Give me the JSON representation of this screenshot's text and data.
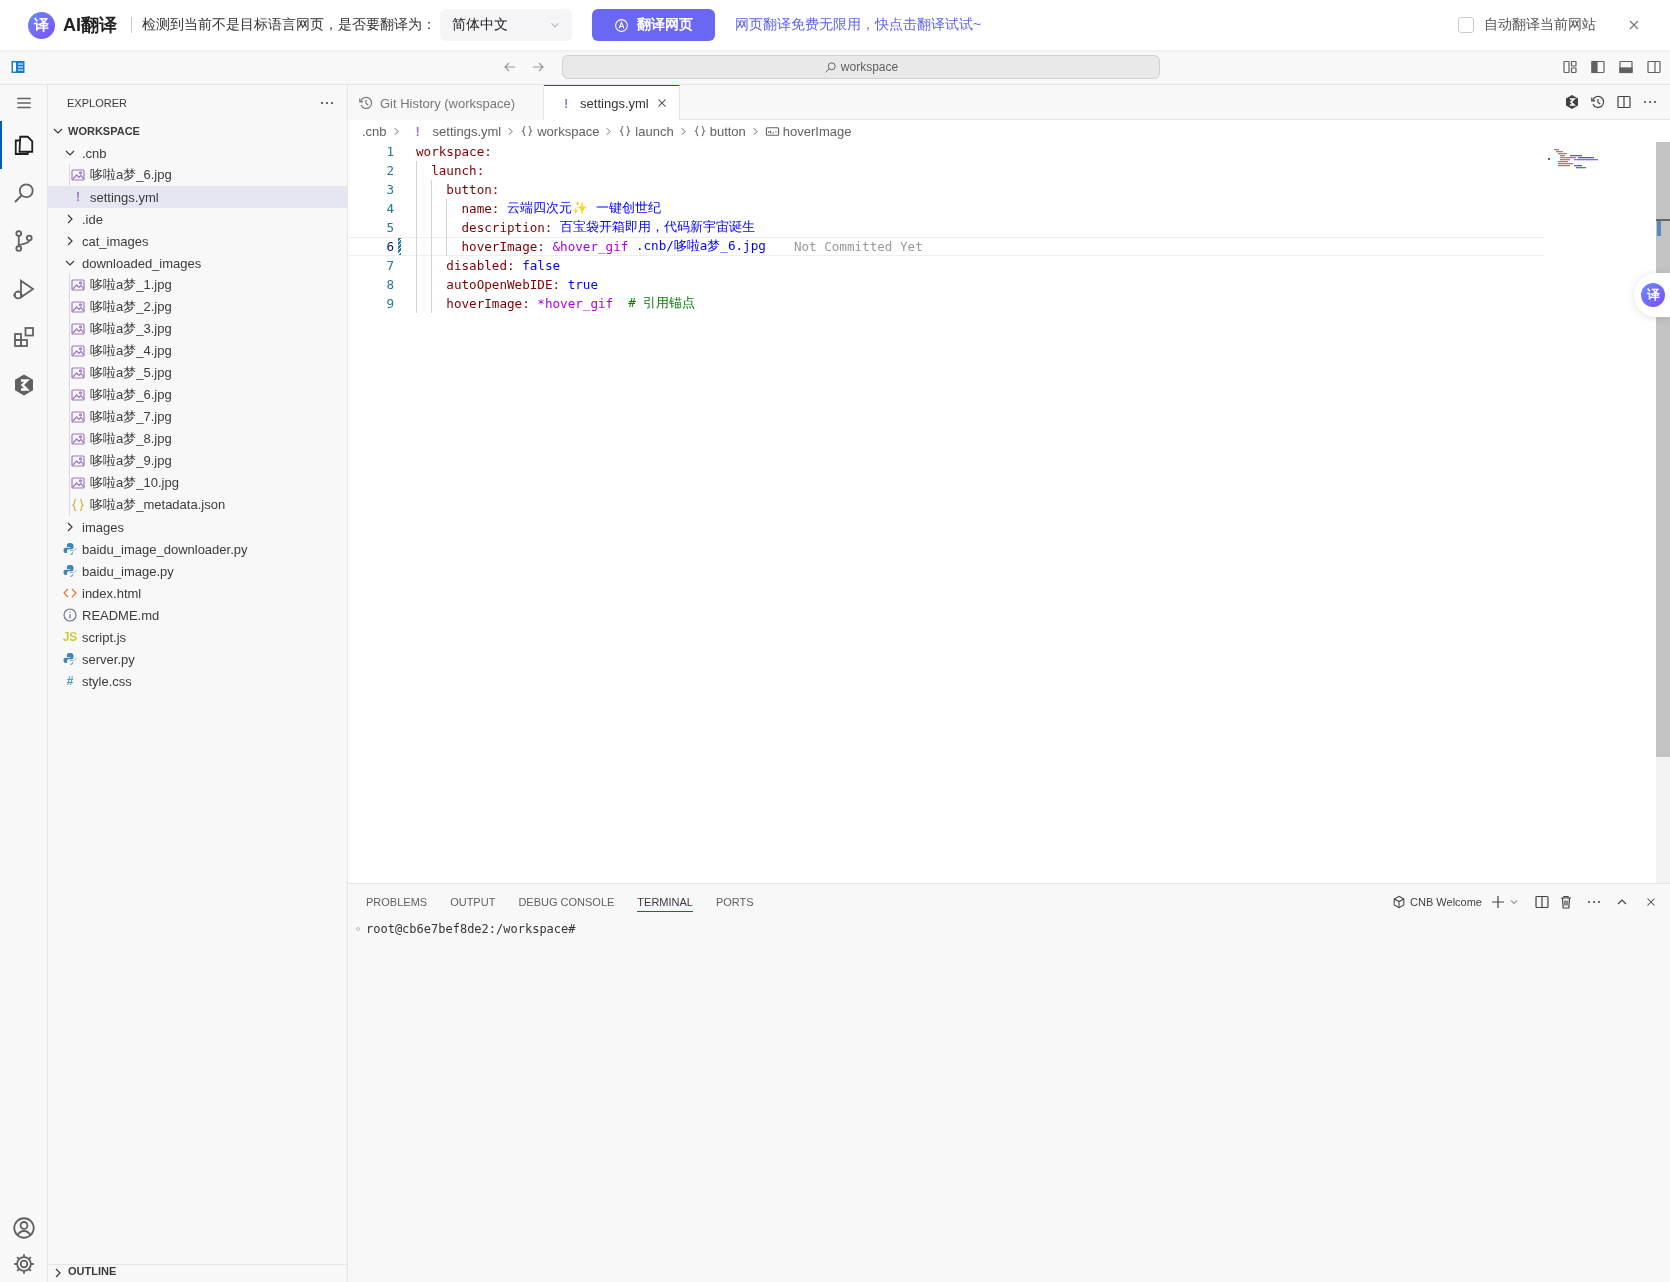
{
  "translate_bar": {
    "logo_icon_text": "译",
    "brand": "AI翻译",
    "prompt": "检测到当前不是目标语言网页，是否要翻译为：",
    "language_select": {
      "value": "简体中文"
    },
    "translate_button": "翻译网页",
    "promo_link": "网页翻译免费无限用，快点击翻译试试~",
    "auto_translate": {
      "label": "自动翻译当前网站",
      "checked": false
    }
  },
  "title_bar": {
    "command_center": "workspace"
  },
  "activity_bar": {
    "items": [
      {
        "kind": "explorer",
        "selected": true
      },
      {
        "kind": "search",
        "selected": false
      },
      {
        "kind": "source-control",
        "selected": false
      },
      {
        "kind": "run-debug",
        "selected": false
      },
      {
        "kind": "extensions",
        "selected": false
      },
      {
        "kind": "cnb",
        "selected": false
      }
    ],
    "bottom_items": [
      {
        "kind": "account"
      },
      {
        "kind": "settings"
      }
    ]
  },
  "explorer": {
    "title": "EXPLORER",
    "section": {
      "title": "WORKSPACE",
      "expanded": true
    },
    "tree": [
      {
        "label": ".cnb",
        "kind": "folder",
        "expanded": true,
        "selected": false,
        "children": [
          {
            "label": "哆啦a梦_6.jpg",
            "kind": "image",
            "selected": false
          },
          {
            "label": "settings.yml",
            "kind": "yaml",
            "icon_text": "!",
            "selected": true
          }
        ]
      },
      {
        "label": ".ide",
        "kind": "folder",
        "expanded": false,
        "selected": false
      },
      {
        "label": "cat_images",
        "kind": "folder",
        "expanded": false,
        "selected": false
      },
      {
        "label": "downloaded_images",
        "kind": "folder",
        "expanded": true,
        "selected": false,
        "children": [
          {
            "label": "哆啦a梦_1.jpg",
            "kind": "image",
            "selected": false
          },
          {
            "label": "哆啦a梦_2.jpg",
            "kind": "image",
            "selected": false
          },
          {
            "label": "哆啦a梦_3.jpg",
            "kind": "image",
            "selected": false
          },
          {
            "label": "哆啦a梦_4.jpg",
            "kind": "image",
            "selected": false
          },
          {
            "label": "哆啦a梦_5.jpg",
            "kind": "image",
            "selected": false
          },
          {
            "label": "哆啦a梦_6.jpg",
            "kind": "image",
            "selected": false
          },
          {
            "label": "哆啦a梦_7.jpg",
            "kind": "image",
            "selected": false
          },
          {
            "label": "哆啦a梦_8.jpg",
            "kind": "image",
            "selected": false
          },
          {
            "label": "哆啦a梦_9.jpg",
            "kind": "image",
            "selected": false
          },
          {
            "label": "哆啦a梦_10.jpg",
            "kind": "image",
            "selected": false
          },
          {
            "label": "哆啦a梦_metadata.json",
            "kind": "json",
            "selected": false
          }
        ]
      },
      {
        "label": "images",
        "kind": "folder",
        "expanded": false,
        "selected": false
      },
      {
        "label": "baidu_image_downloader.py",
        "kind": "python",
        "selected": false
      },
      {
        "label": "baidu_image.py",
        "kind": "python",
        "selected": false
      },
      {
        "label": "index.html",
        "kind": "html",
        "selected": false
      },
      {
        "label": "README.md",
        "kind": "info",
        "selected": false
      },
      {
        "label": "script.js",
        "kind": "js",
        "icon_text": "JS",
        "selected": false
      },
      {
        "label": "server.py",
        "kind": "python",
        "selected": false
      },
      {
        "label": "style.css",
        "kind": "css",
        "icon_text": "#",
        "selected": false
      }
    ],
    "outline": {
      "title": "OUTLINE",
      "expanded": false
    }
  },
  "editor": {
    "tabs": [
      {
        "label": "Git History (workspace)",
        "kind": "history",
        "selected": false
      },
      {
        "label": "settings.yml",
        "kind": "yaml",
        "icon_text": "!",
        "selected": true
      }
    ],
    "breadcrumb": [
      {
        "label": ".cnb",
        "kind": "folder"
      },
      {
        "label": "settings.yml",
        "kind": "yaml",
        "icon_text": "!"
      },
      {
        "label": "workspace",
        "kind": "object"
      },
      {
        "label": "launch",
        "kind": "object"
      },
      {
        "label": "button",
        "kind": "object"
      },
      {
        "label": "hoverImage",
        "kind": "string"
      }
    ],
    "lines": [
      {
        "number": "1",
        "current": false,
        "modified": false,
        "tokens": [
          {
            "kind": "key",
            "text": "workspace:"
          }
        ],
        "children": [
          {
            "number": "2",
            "current": false,
            "modified": false,
            "tokens": [
              {
                "kind": "key",
                "text": "launch:"
              }
            ],
            "children": [
              {
                "number": "3",
                "current": false,
                "modified": false,
                "tokens": [
                  {
                    "kind": "key",
                    "text": "button:"
                  }
                ],
                "children": [
                  {
                    "number": "4",
                    "current": false,
                    "modified": false,
                    "tokens": [
                      {
                        "kind": "key",
                        "text": "name: "
                      },
                      {
                        "kind": "string",
                        "text": "云端四次元✨ 一键创世纪"
                      }
                    ]
                  },
                  {
                    "number": "5",
                    "current": false,
                    "modified": false,
                    "tokens": [
                      {
                        "kind": "key",
                        "text": "description: "
                      },
                      {
                        "kind": "string",
                        "text": "百宝袋开箱即用，代码新宇宙诞生"
                      }
                    ]
                  },
                  {
                    "number": "6",
                    "current": true,
                    "modified": true,
                    "blame": "Not Committed Yet",
                    "tokens": [
                      {
                        "kind": "key",
                        "text": "hoverImage: "
                      },
                      {
                        "kind": "anchor",
                        "text": "&hover_gif"
                      },
                      {
                        "kind": "string",
                        "text": " .cnb/哆啦a梦_6.jpg"
                      }
                    ]
                  }
                ]
              },
              {
                "number": "7",
                "current": false,
                "modified": false,
                "tokens": [
                  {
                    "kind": "key",
                    "text": "disabled: "
                  },
                  {
                    "kind": "bool",
                    "text": "false"
                  }
                ]
              },
              {
                "number": "8",
                "current": false,
                "modified": false,
                "tokens": [
                  {
                    "kind": "key",
                    "text": "autoOpenWebIDE: "
                  },
                  {
                    "kind": "bool",
                    "text": "true"
                  }
                ]
              },
              {
                "number": "9",
                "current": false,
                "modified": false,
                "tokens": [
                  {
                    "kind": "key",
                    "text": "hoverImage: "
                  },
                  {
                    "kind": "anchor",
                    "text": "*hover_gif"
                  },
                  {
                    "kind": "comment",
                    "text": "# 引用锚点"
                  }
                ]
              }
            ]
          }
        ]
      }
    ]
  },
  "panel": {
    "tabs": [
      {
        "label": "PROBLEMS",
        "selected": false
      },
      {
        "label": "OUTPUT",
        "selected": false
      },
      {
        "label": "DEBUG CONSOLE",
        "selected": false
      },
      {
        "label": "TERMINAL",
        "selected": true
      },
      {
        "label": "PORTS",
        "selected": false
      }
    ],
    "terminal": {
      "name": "CNB Welcome",
      "lines": [
        "root@cb6e7bef8de2:/workspace#"
      ]
    }
  },
  "float_button": {
    "label": "译"
  }
}
